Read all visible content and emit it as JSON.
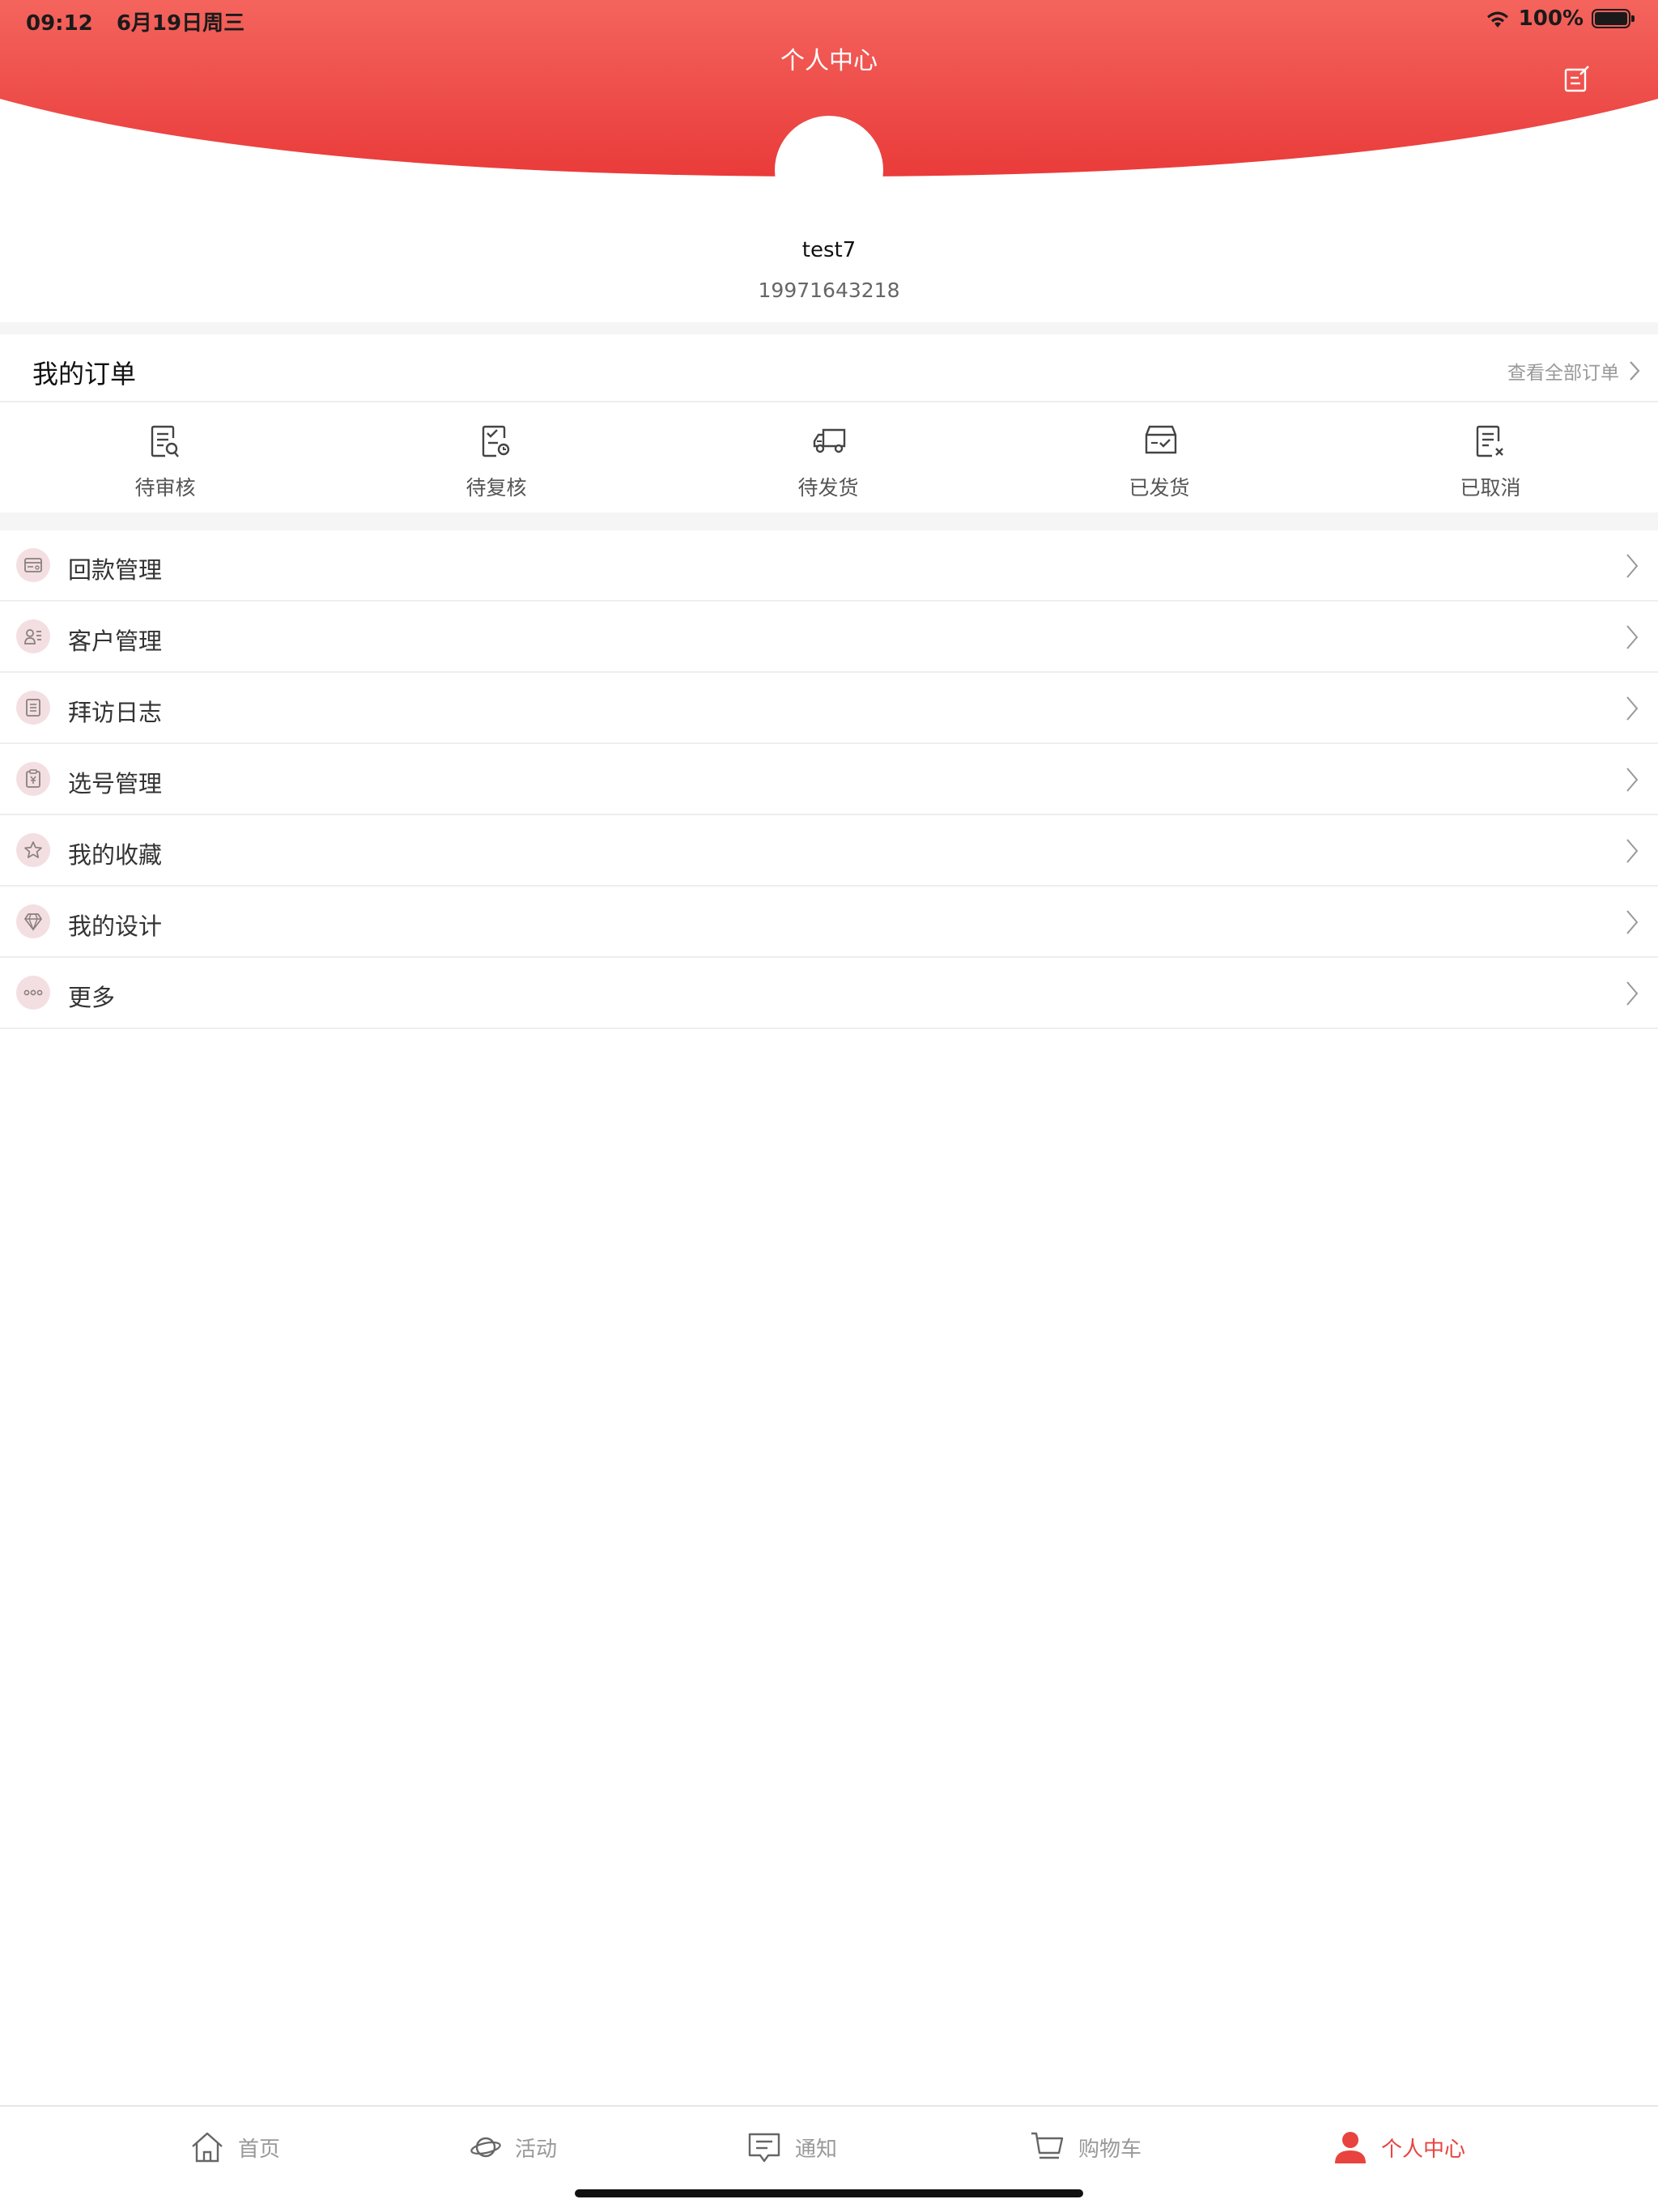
{
  "status_bar": {
    "time": "09:12",
    "date": "6月19日周三",
    "battery": "100%"
  },
  "header": {
    "title": "个人中心",
    "edit_icon": "edit-icon",
    "gradient_top": "#f4645d",
    "gradient_bottom": "#e93b3a"
  },
  "profile": {
    "username": "test7",
    "phone": "19971643218"
  },
  "orders": {
    "title": "我的订单",
    "view_all": "查看全部订单",
    "items": [
      {
        "label": "待审核",
        "icon": "pending-review-icon"
      },
      {
        "label": "待复核",
        "icon": "pending-recheck-icon"
      },
      {
        "label": "待发货",
        "icon": "truck-icon"
      },
      {
        "label": "已发货",
        "icon": "shipped-box-icon"
      },
      {
        "label": "已取消",
        "icon": "cancelled-doc-icon"
      }
    ]
  },
  "menu": {
    "items": [
      {
        "label": "回款管理",
        "icon": "payment-card-icon"
      },
      {
        "label": "客户管理",
        "icon": "customer-card-icon"
      },
      {
        "label": "拜访日志",
        "icon": "log-list-icon"
      },
      {
        "label": "选号管理",
        "icon": "number-tag-icon"
      },
      {
        "label": "我的收藏",
        "icon": "star-icon"
      },
      {
        "label": "我的设计",
        "icon": "diamond-icon"
      },
      {
        "label": "更多",
        "icon": "more-dots-icon"
      }
    ]
  },
  "tabbar": {
    "active_color": "#e8433f",
    "items": [
      {
        "label": "首页",
        "icon": "home-icon"
      },
      {
        "label": "活动",
        "icon": "planet-icon"
      },
      {
        "label": "通知",
        "icon": "message-icon"
      },
      {
        "label": "购物车",
        "icon": "cart-icon"
      },
      {
        "label": "个人中心",
        "icon": "person-icon",
        "active": true
      }
    ]
  }
}
